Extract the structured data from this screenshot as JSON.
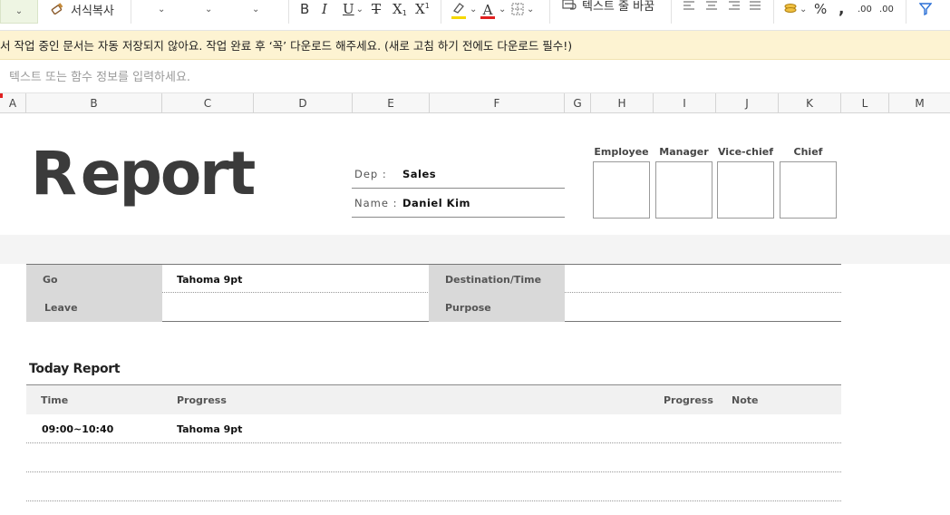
{
  "toolbar": {
    "format_painter_label": "서식복사",
    "wrap_text_label": "텍스트 줄 바꿈",
    "bold": "B",
    "italic": "I",
    "underline": "U",
    "strikethrough": "T",
    "subscript": "X",
    "superscript": "X",
    "font_color_letter": "A",
    "percent": "%",
    "comma": ",",
    "decimal_increase": ".00",
    "decimal_decrease": ".00",
    "highlight_color": "#f5d800",
    "font_color": "#e02020"
  },
  "notice": {
    "text": "서 작업 중인 문서는 자동 저장되지 않아요. 작업 완료 후 ‘꼭’ 다운로드 해주세요. (새로 고침 하기 전에도 다운로드 필수!)"
  },
  "formula_bar": {
    "placeholder": "텍스트 또는 함수 정보를 입력하세요."
  },
  "columns": [
    "A",
    "B",
    "C",
    "D",
    "E",
    "F",
    "G",
    "H",
    "I",
    "J",
    "K",
    "L",
    "M"
  ],
  "report": {
    "title_first": "R",
    "title_rest": "eport",
    "dep_label": "Dep  :",
    "dep_value": "Sales",
    "name_label": "Name :",
    "name_value": "Daniel Kim",
    "approvals": [
      "Employee",
      "Manager",
      "Vice-chief",
      "Chief"
    ],
    "go_label": "Go",
    "go_value": "Tahoma 9pt",
    "leave_label": "Leave",
    "leave_value": "",
    "destination_label": "Destination/Time",
    "destination_value": "",
    "purpose_label": "Purpose",
    "purpose_value": "",
    "today_title": "Today Report",
    "table_headers": {
      "time": "Time",
      "progress": "Progress",
      "progress2": "Progress",
      "note": "Note"
    },
    "rows": [
      {
        "time": "09:00~10:40",
        "progress": "Tahoma 9pt",
        "progress2": "",
        "note": ""
      },
      {
        "time": "",
        "progress": "",
        "progress2": "",
        "note": ""
      },
      {
        "time": "",
        "progress": "",
        "progress2": "",
        "note": ""
      }
    ]
  }
}
